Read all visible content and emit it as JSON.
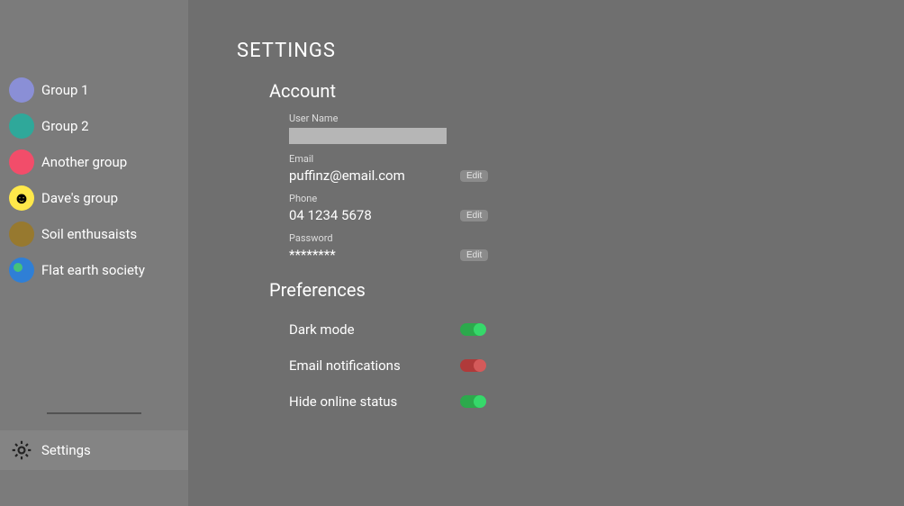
{
  "sidebar": {
    "groups": [
      {
        "label": "Group 1",
        "color": "#8a8fd6"
      },
      {
        "label": "Group 2",
        "color": "#2fa89a"
      },
      {
        "label": "Another group",
        "color": "#f24d6a"
      },
      {
        "label": "Dave's group",
        "color": "smiley"
      },
      {
        "label": "Soil enthusaists",
        "color": "#97792f"
      },
      {
        "label": "Flat earth society",
        "color": "flatearth"
      }
    ],
    "settings_label": "Settings"
  },
  "page": {
    "title": "SETTINGS"
  },
  "account": {
    "heading": "Account",
    "username_label": "User Name",
    "username_value": "",
    "email_label": "Email",
    "email_value": "puffinz@email.com",
    "phone_label": "Phone",
    "phone_value": "04 1234 5678",
    "password_label": "Password",
    "password_value": "********",
    "edit_label": "Edit"
  },
  "preferences": {
    "heading": "Preferences",
    "items": [
      {
        "label": "Dark mode",
        "on": true
      },
      {
        "label": "Email notifications",
        "on": false
      },
      {
        "label": "Hide online status",
        "on": true
      }
    ]
  }
}
